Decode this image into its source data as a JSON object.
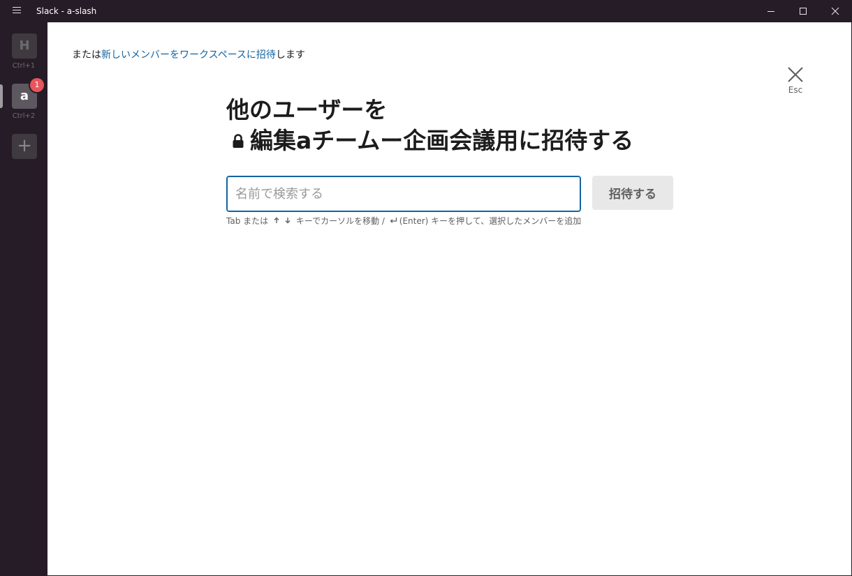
{
  "window": {
    "title": "Slack - a-slash"
  },
  "icons": {
    "menu": "hamburger-icon",
    "minimize": "minimize-icon",
    "maximize": "maximize-icon",
    "close": "close-icon",
    "lock": "lock-icon",
    "arrow_up": "arrow-up-icon",
    "arrow_down": "arrow-down-icon",
    "enter": "enter-key-icon",
    "add": "plus-icon"
  },
  "colors": {
    "sidebar_bg": "#261c27",
    "link": "#1264a3",
    "badge": "#e8555d",
    "input_focus": "#1264a3"
  },
  "workspaces": [
    {
      "initial": "H",
      "shortcut": "Ctrl+1"
    },
    {
      "initial": "a",
      "shortcut": "Ctrl+2",
      "badge": "1",
      "active": true
    }
  ],
  "add_workspace": "+",
  "invite": {
    "or_prefix": "または",
    "link_text": "新しいメンバーをワークスペースに招待",
    "or_suffix": "します",
    "esc_label": "Esc",
    "heading_line1": "他のユーザーを",
    "heading_line2": "編集aチームー企画会議用に招待する",
    "search_placeholder": "名前で検索する",
    "search_value": "",
    "button_label": "招待する",
    "hint_part1": "Tab または",
    "hint_part2": "キーでカーソルを移動 /",
    "hint_part3": "(Enter) キーを押して、選択したメンバーを追加"
  }
}
